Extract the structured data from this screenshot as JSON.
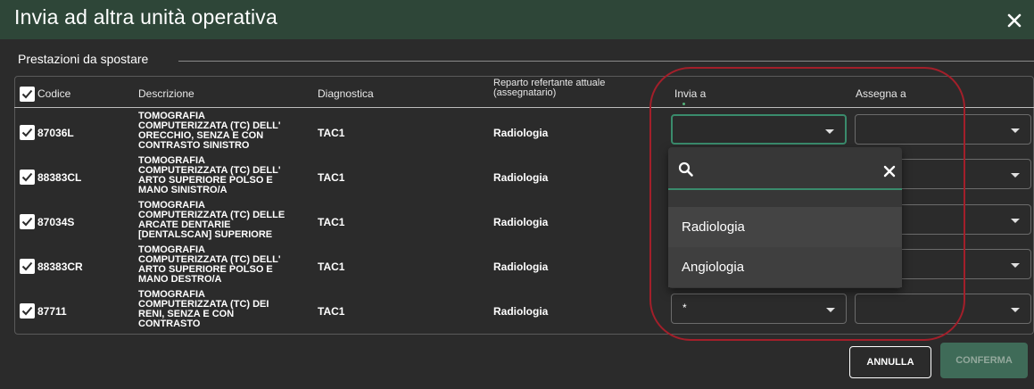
{
  "dialog": {
    "title": "Invia ad altra unità operativa",
    "close_icon": "close-icon",
    "accent_color": "#2e4638",
    "focus_color": "#3a8b6c",
    "highlight_color": "#a31f2a"
  },
  "section": {
    "label": "Prestazioni da spostare"
  },
  "table": {
    "columns": {
      "codice": "Codice",
      "descrizione": "Descrizione",
      "diagnostica": "Diagnostica",
      "reparto_line1": "Reparto refertante attuale",
      "reparto_line2": "(assegnatario)",
      "invia_a": "Invia a",
      "assegna_a": "Assegna a"
    },
    "select_all_checked": true,
    "rows": [
      {
        "checked": true,
        "code": "87036L",
        "desc": [
          "TOMOGRAFIA",
          "COMPUTERIZZATA (TC) DELL'",
          "ORECCHIO, SENZA E CON",
          "CONTRASTO SINISTRO"
        ],
        "diag": "TAC1",
        "reparto": "Radiologia",
        "invia_value": "",
        "assegna_value": ""
      },
      {
        "checked": true,
        "code": "88383CL",
        "desc": [
          "TOMOGRAFIA",
          "COMPUTERIZZATA (TC) DELL'",
          "ARTO SUPERIORE POLSO E",
          "MANO SINISTRO/A"
        ],
        "diag": "TAC1",
        "reparto": "Radiologia",
        "invia_value": "",
        "assegna_value": ""
      },
      {
        "checked": true,
        "code": "87034S",
        "desc": [
          "TOMOGRAFIA",
          "COMPUTERIZZATA (TC) DELLE",
          "ARCATE DENTARIE",
          "[DENTALSCAN] SUPERIORE"
        ],
        "diag": "TAC1",
        "reparto": "Radiologia",
        "invia_value": "",
        "assegna_value": ""
      },
      {
        "checked": true,
        "code": "88383CR",
        "desc": [
          "TOMOGRAFIA",
          "COMPUTERIZZATA (TC) DELL'",
          "ARTO SUPERIORE POLSO E",
          "MANO DESTRO/A"
        ],
        "diag": "TAC1",
        "reparto": "Radiologia",
        "invia_value": "",
        "assegna_value": ""
      },
      {
        "checked": true,
        "code": "87711",
        "desc": [
          "TOMOGRAFIA",
          "COMPUTERIZZATA (TC) DEI",
          "RENI, SENZA E CON",
          "CONTRASTO"
        ],
        "diag": "TAC1",
        "reparto": "Radiologia",
        "invia_value": "*",
        "assegna_value": ""
      }
    ]
  },
  "dropdown": {
    "search_icon": "search-icon",
    "clear_icon": "close-icon",
    "search_value": "",
    "options": [
      "Radiologia",
      "Angiologia"
    ]
  },
  "actions": {
    "cancel_label": "ANNULLA",
    "confirm_label": "CONFERMA",
    "confirm_enabled": false
  }
}
